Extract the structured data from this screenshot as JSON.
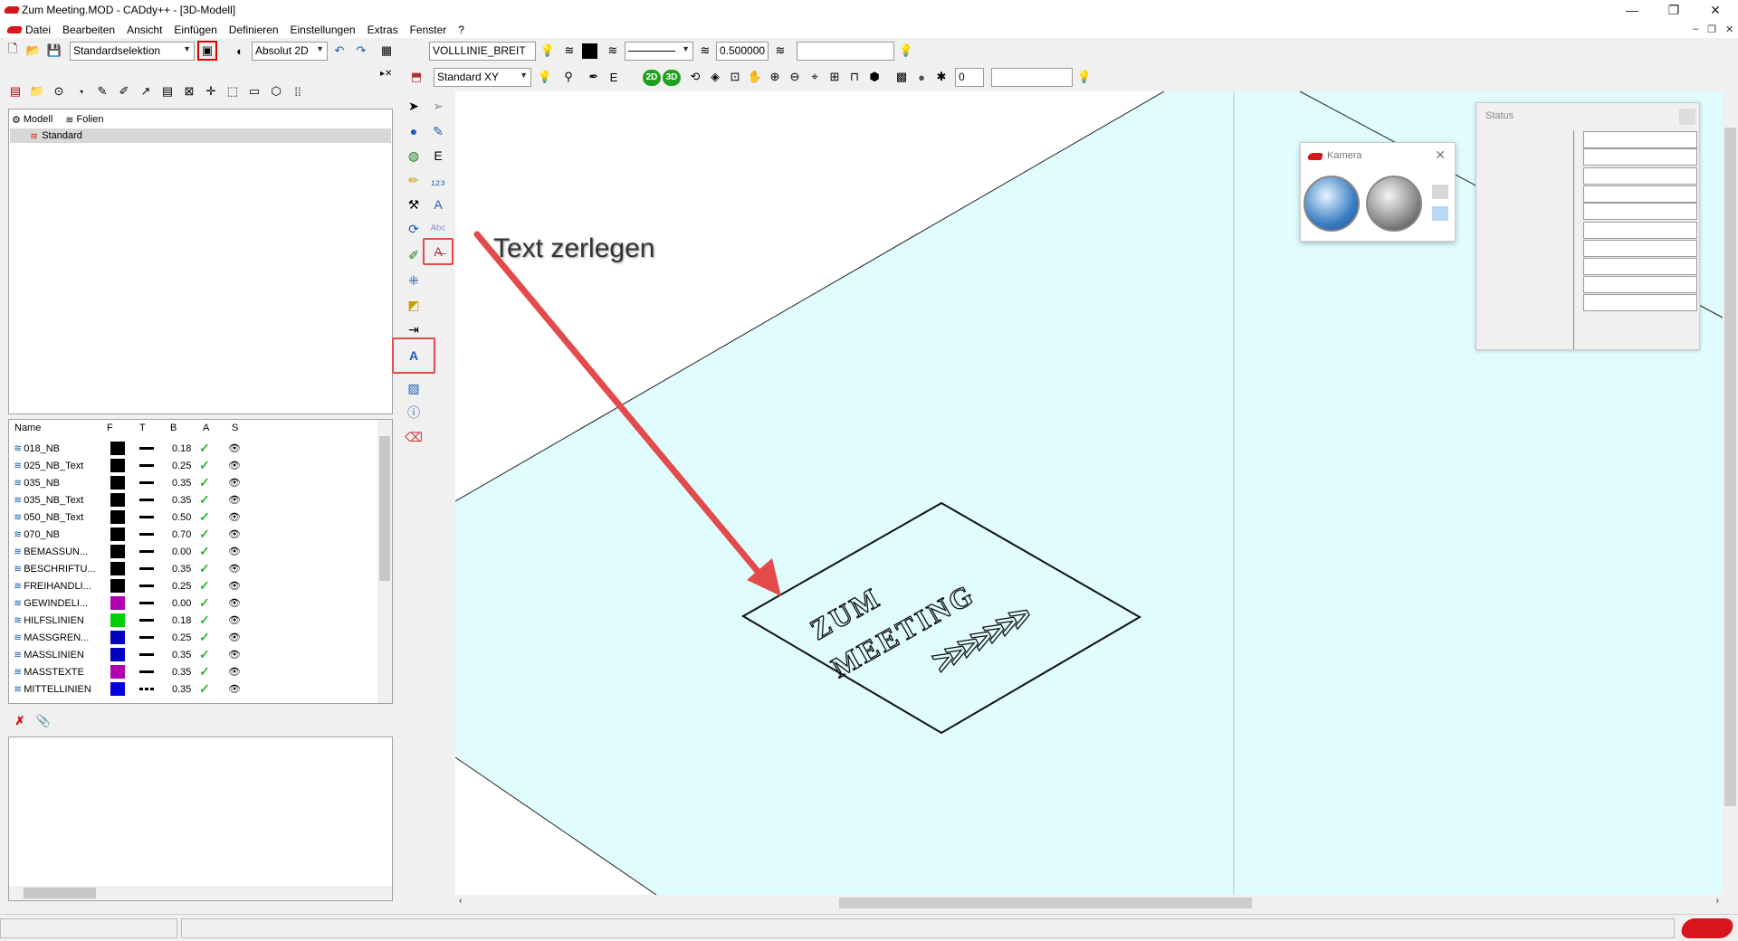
{
  "window": {
    "title": "Zum Meeting.MOD  -  CADdy++ - [3D-Modell]",
    "controls": [
      "—",
      "❐",
      "✕"
    ],
    "mdi_controls": [
      "–",
      "❐",
      "✕"
    ]
  },
  "menubar": [
    "Datei",
    "Bearbeiten",
    "Ansicht",
    "Einfügen",
    "Definieren",
    "Einstellungen",
    "Extras",
    "Fenster",
    "?"
  ],
  "toolbar1": {
    "selection": "Standardselektion",
    "coord_mode": "Absolut 2D",
    "line_type": "VOLLLINIE_BREIT",
    "line_width": "0.500000",
    "text_field": ""
  },
  "toolbar2": {
    "view": "Standard XY",
    "number": "0",
    "text_field": "",
    "btn_2d": "2D",
    "btn_3d": "3D"
  },
  "left_panel": {
    "tabs": [
      "Modell",
      "Folien"
    ],
    "folien_tree": [
      "Standard"
    ],
    "layer_columns": [
      "Name",
      "F",
      "T",
      "B",
      "A",
      "S"
    ],
    "layers": [
      {
        "name": "018_NB",
        "color": "#000000",
        "line": "solid",
        "width": "0.18"
      },
      {
        "name": "025_NB_Text",
        "color": "#000000",
        "line": "solid",
        "width": "0.25"
      },
      {
        "name": "035_NB",
        "color": "#000000",
        "line": "solid",
        "width": "0.35"
      },
      {
        "name": "035_NB_Text",
        "color": "#000000",
        "line": "solid",
        "width": "0.35"
      },
      {
        "name": "050_NB_Text",
        "color": "#000000",
        "line": "solid",
        "width": "0.50"
      },
      {
        "name": "070_NB",
        "color": "#000000",
        "line": "solid",
        "width": "0.70"
      },
      {
        "name": "BEMASSUN...",
        "color": "#000000",
        "line": "solid",
        "width": "0.00"
      },
      {
        "name": "BESCHRIFTU...",
        "color": "#000000",
        "line": "solid",
        "width": "0.35"
      },
      {
        "name": "FREIHANDLI...",
        "color": "#000000",
        "line": "solid",
        "width": "0.25"
      },
      {
        "name": "GEWINDELI...",
        "color": "#b000b0",
        "line": "solid",
        "width": "0.00"
      },
      {
        "name": "HILFSLINIEN",
        "color": "#00d000",
        "line": "solid",
        "width": "0.18"
      },
      {
        "name": "MASSGREN...",
        "color": "#0000c0",
        "line": "solid",
        "width": "0.25"
      },
      {
        "name": "MASSLINIEN",
        "color": "#0000c0",
        "line": "solid",
        "width": "0.35"
      },
      {
        "name": "MASSTEXTE",
        "color": "#b000b0",
        "line": "solid",
        "width": "0.35"
      },
      {
        "name": "MITTELLINIEN",
        "color": "#0000e0",
        "line": "dashed",
        "width": "0.35"
      }
    ]
  },
  "annotation": {
    "label": "Text zerlegen"
  },
  "drawing": {
    "line1": "ZUM",
    "line2": "MEETING",
    "arrows": ">>>>>>>"
  },
  "camera_panel": {
    "title": "Kamera"
  },
  "status_panel": {
    "title": "Status"
  },
  "colors": {
    "canvas_bg": "#e0fcfe",
    "highlight": "#e34a4a"
  }
}
